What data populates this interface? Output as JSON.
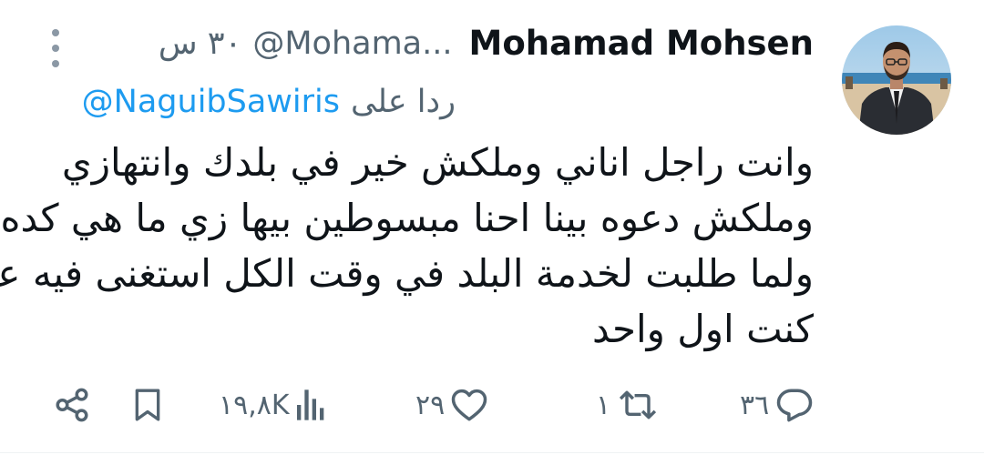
{
  "tweet": {
    "author": {
      "display_name": "Mohamad Mohsen",
      "handle": "@Mohama...",
      "avatar_icon": "profile-photo"
    },
    "time": "٣٠ س",
    "reply_to": {
      "label": "ردا على",
      "handle": "@NaguibSawiris"
    },
    "text_lines": [
      "وانت راجل اناني وملكش خير في بلدك وانتهازي",
      "وملكش دعوه بينا احنا مبسوطين بيها زي ما هي كده",
      "ولما طلبت لخدمة البلد في وقت الكل استغنى فيه عنها",
      "كنت اول واحد"
    ],
    "actions": {
      "replies": "٣٦",
      "retweets": "١",
      "likes": "٢٩",
      "views": "١٩,٨K"
    },
    "colors": {
      "accent": "#1d9bf0",
      "secondary_text": "#536471",
      "primary_text": "#0f1419"
    }
  }
}
